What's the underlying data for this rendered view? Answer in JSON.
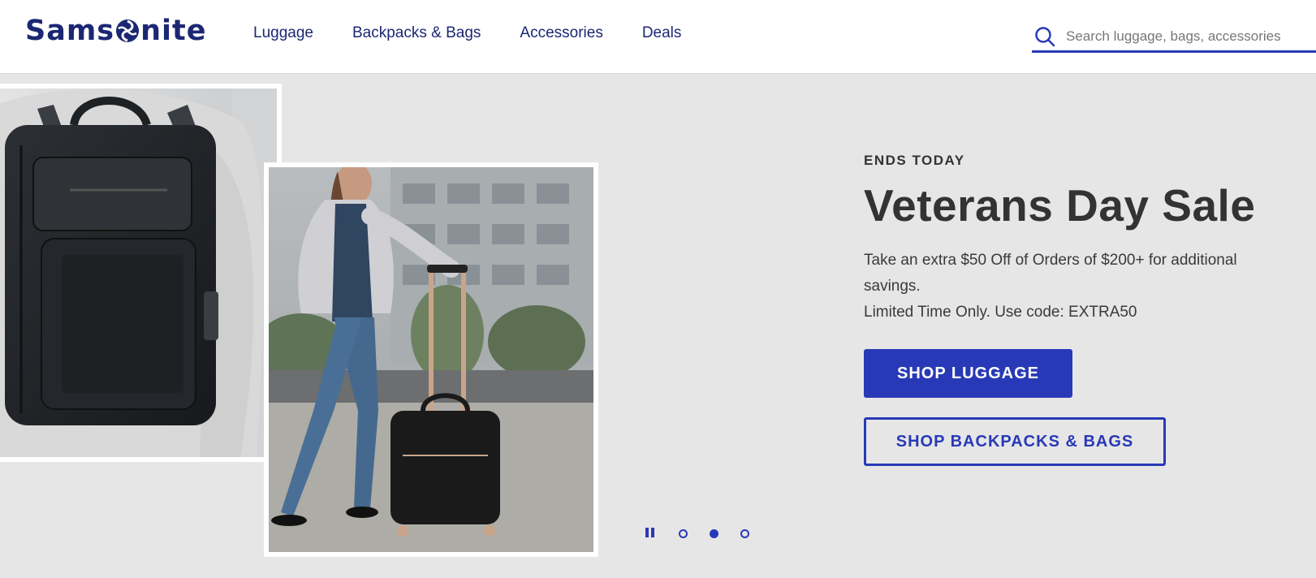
{
  "brand": {
    "logo_text_left": "Sams",
    "logo_text_right": "nite",
    "logo_alt": "Samsonite",
    "color": "#1c2773"
  },
  "nav": {
    "items": [
      {
        "label": "Luggage"
      },
      {
        "label": "Backpacks & Bags"
      },
      {
        "label": "Accessories"
      },
      {
        "label": "Deals"
      }
    ]
  },
  "search": {
    "placeholder": "Search luggage, bags, accessories",
    "icon": "search-icon"
  },
  "hero": {
    "eyebrow": "ENDS TODAY",
    "headline": "Veterans Day Sale",
    "body_line1": "Take an extra $50 Off of Orders of $200+ for additional savings.",
    "body_line2": "Limited Time Only. Use code: EXTRA50",
    "primary_button": "SHOP LUGGAGE",
    "secondary_button": "SHOP BACKPACKS & BAGS",
    "background": "#e6e6e6",
    "accent": "#2839b7"
  },
  "carousel": {
    "slide_count": 3,
    "active_index": 1,
    "pause_icon": "pause-icon"
  }
}
